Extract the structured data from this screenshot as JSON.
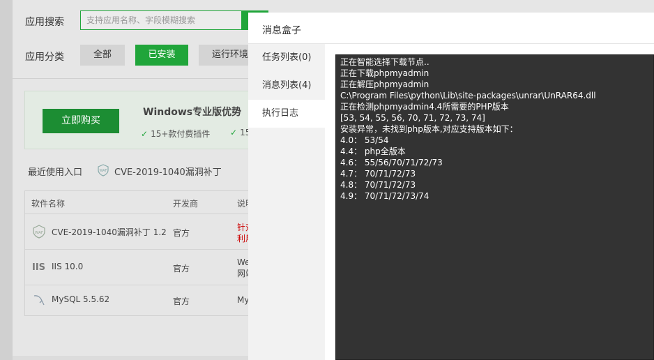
{
  "background": {
    "search": {
      "label": "应用搜索",
      "placeholder": "支持应用名称、字段模糊搜索"
    },
    "category": {
      "label": "应用分类",
      "buttons": [
        "全部",
        "已安装",
        "运行环境"
      ]
    },
    "promo": {
      "buy_label": "立即购买",
      "title": "Windows专业版优势",
      "feature": "15+款付费插件",
      "feature2_fragment": "15"
    },
    "recent": {
      "label": "最近使用入口",
      "item": "CVE-2019-1040漏洞补丁"
    },
    "table": {
      "headers": [
        "软件名称",
        "开发商",
        "说明"
      ],
      "rows": [
        {
          "icon": "waf-icon",
          "icon_text": "WAF",
          "name": "CVE-2019-1040漏洞补丁 1.2",
          "developer": "官方",
          "desc_line1": "针对",
          "desc_line2": "利用",
          "desc_color": "#cc0000"
        },
        {
          "icon": "iis-icon",
          "icon_text": "IIS",
          "name": "IIS 10.0",
          "developer": "官方",
          "desc_line1": "We",
          "desc_line2": "网站"
        },
        {
          "icon": "mysql-icon",
          "icon_text": "",
          "name": "MySQL 5.5.62",
          "developer": "官方",
          "desc_line1": "My",
          "desc_line2": ""
        }
      ]
    }
  },
  "modal": {
    "title": "消息盒子",
    "sidebar": [
      {
        "label": "任务列表(0)",
        "active": false
      },
      {
        "label": "消息列表(4)",
        "active": false
      },
      {
        "label": "执行日志",
        "active": true
      }
    ],
    "log_lines": [
      "正在智能选择下载节点..",
      "正在下载phpmyadmin",
      "正在解压phpmyadmin",
      "C:\\Program Files\\python\\Lib\\site-packages\\unrar\\UnRAR64.dll",
      "正在检测phpmyadmin4.4所需要的PHP版本",
      "[53, 54, 55, 56, 70, 71, 72, 73, 74]",
      "安装异常，未找到php版本,对应支持版本如下：",
      "4.0： 53/54",
      "4.4： php全版本",
      "4.6： 55/56/70/71/72/73",
      "4.7： 70/71/72/73",
      "4.8： 70/71/72/73",
      "4.9： 70/71/72/73/74"
    ]
  },
  "colors": {
    "accent": "#20a53a",
    "console_bg": "#333333"
  }
}
